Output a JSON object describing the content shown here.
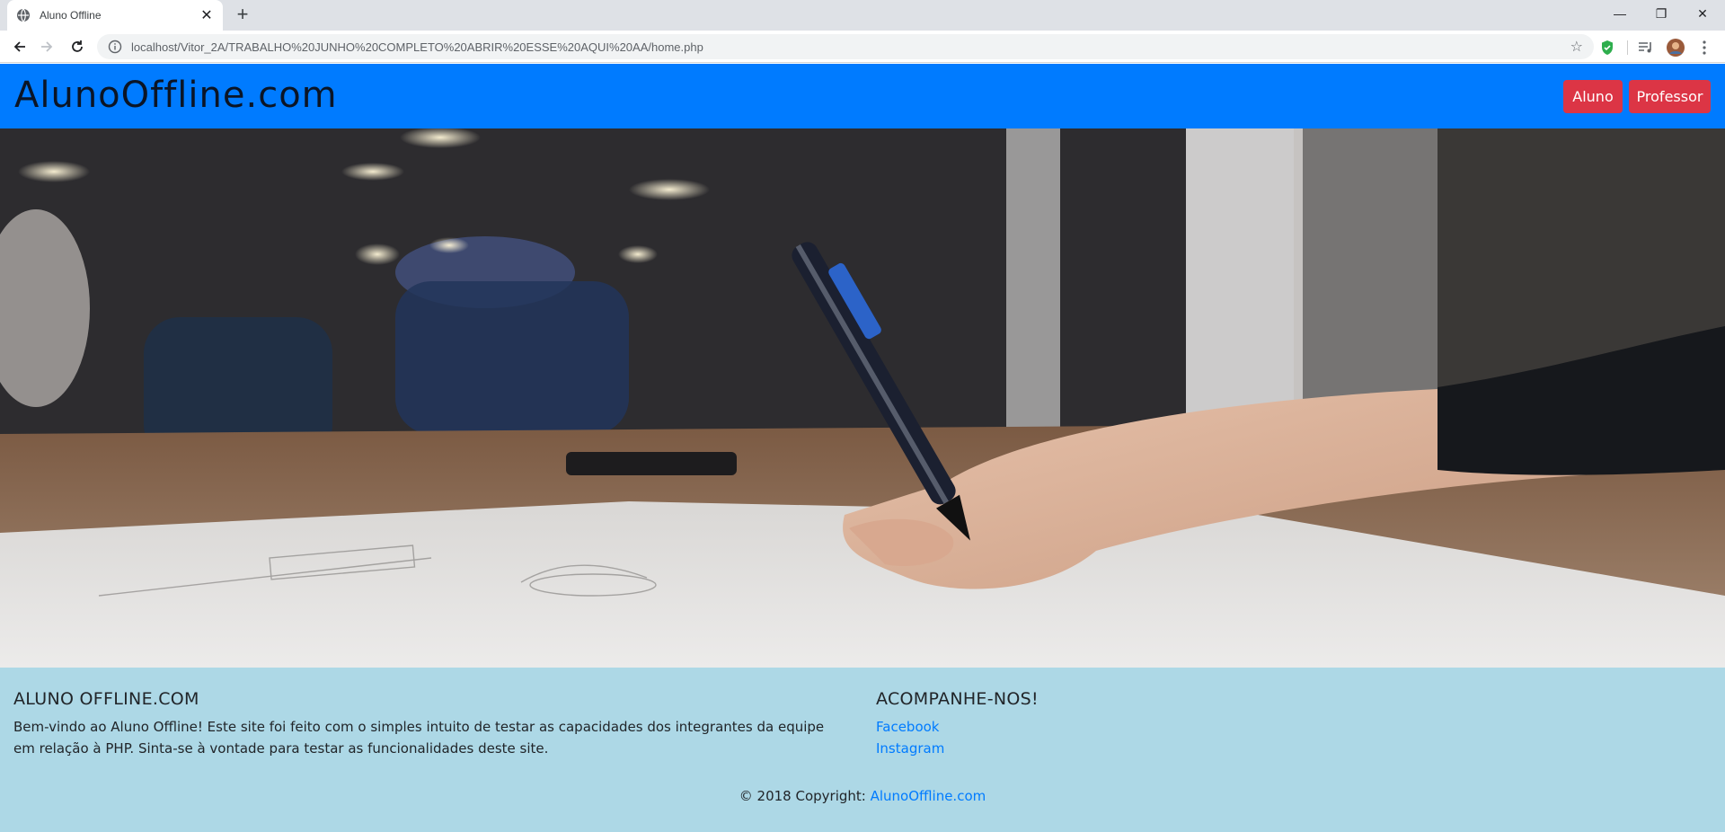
{
  "browser": {
    "tab_title": "Aluno Offline",
    "new_tab": "+",
    "url": "localhost/Vitor_2A/TRABALHO%20JUNHO%20COMPLETO%20ABRIR%20ESSE%20AQUI%20AA/home.php"
  },
  "site": {
    "brand": "AlunoOffline.com",
    "nav": {
      "aluno_label": "Aluno",
      "professor_label": "Professor"
    },
    "colors": {
      "navbar": "#007bff",
      "button": "#dc3545",
      "footer": "#add8e6",
      "link": "#007bff"
    }
  },
  "footer": {
    "about_title": "ALUNO OFFLINE.COM",
    "about_text": "Bem-vindo ao Aluno Offline! Este site foi feito com o simples intuito de testar as capacidades dos integrantes da equipe em relação à PHP. Sinta-se à vontade para testar as funcionalidades deste site.",
    "follow_title": "ACOMPANHE-NOS!",
    "links": [
      "Facebook",
      "Instagram"
    ],
    "copyright_prefix": "© 2018 Copyright: ",
    "copyright_link": "AlunoOffline.com"
  }
}
